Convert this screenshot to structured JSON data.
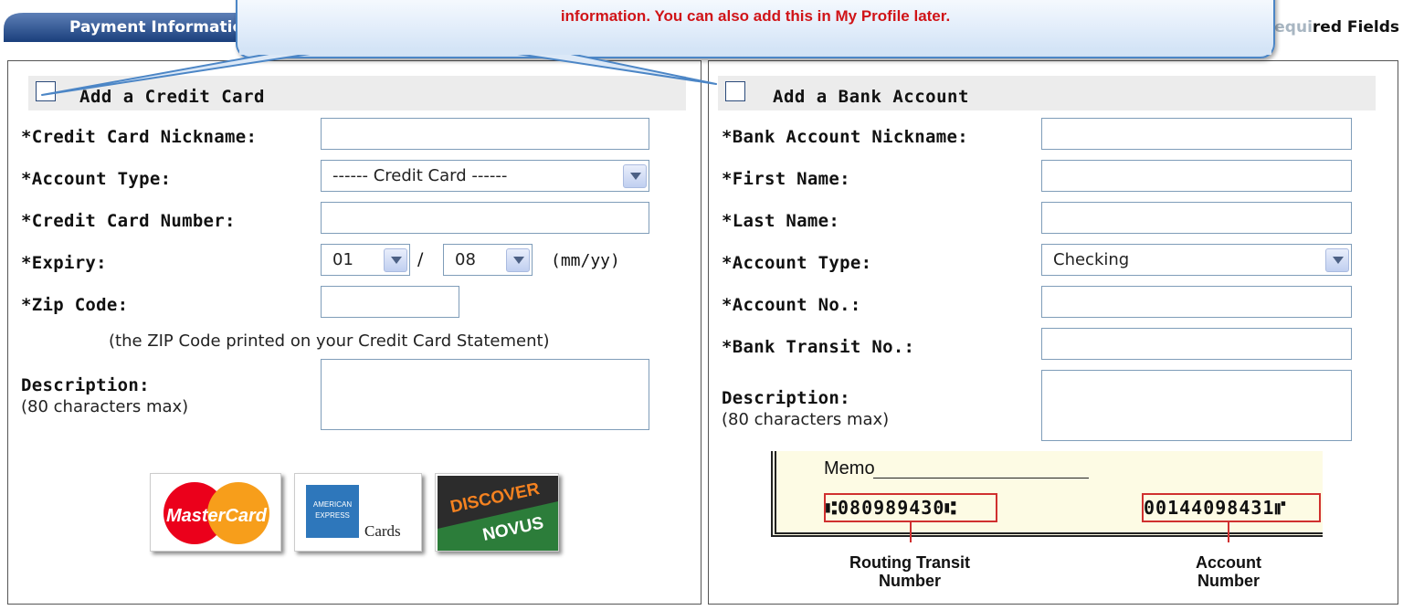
{
  "header": {
    "tab_label": "Payment Information",
    "required_star": "*",
    "required_faded": "Requi",
    "required_dark": "red Fields"
  },
  "callout": {
    "text": "information.  You can also add this in My Profile later."
  },
  "credit_card": {
    "title": "Add a Credit Card",
    "nickname_label": "*Credit Card Nickname:",
    "account_type_label": "*Account Type:",
    "account_type_value": "------ Credit Card ------",
    "number_label": "*Credit Card Number:",
    "expiry_label": "*Expiry:",
    "expiry_month": "01",
    "expiry_sep": "/",
    "expiry_year": "08",
    "expiry_format": "(mm/yy)",
    "zip_label": "*Zip Code:",
    "zip_note": "(the ZIP Code printed on your Credit Card Statement)",
    "desc_label": "Description:",
    "desc_note": "(80 characters max)",
    "logos": {
      "mastercard": "MasterCard",
      "amex_top": "AMERICAN",
      "amex_bottom": "EXPRESS",
      "amex_cards": "Cards",
      "discover": "DISCOVER",
      "novus": "NOVUS"
    }
  },
  "bank": {
    "title": "Add a Bank Account",
    "nickname_label": "*Bank Account Nickname:",
    "first_name_label": "*First Name:",
    "last_name_label": "*Last Name:",
    "account_type_label": "*Account Type:",
    "account_type_value": "Checking",
    "account_no_label": "*Account No.:",
    "transit_label": "*Bank Transit No.:",
    "desc_label": "Description:",
    "desc_note": "(80 characters max)",
    "check": {
      "memo": "Memo",
      "routing_digits": "⑆080989430⑆",
      "account_digits": "00144098431⑈",
      "routing_caption_1": "Routing Transit",
      "routing_caption_2": "Number",
      "account_caption_1": "Account",
      "account_caption_2": "Number"
    }
  },
  "colors": {
    "tab": "#1f4a8a",
    "callout_text": "#d01418",
    "callout_border": "#4c86c6",
    "field_border": "#7f9db9",
    "mastercard_red": "#eb001b",
    "mastercard_yellow": "#f79e1b",
    "amex_blue": "#2e77bb",
    "discover_orange": "#f58220",
    "novus_green": "#2c7d3a",
    "micr_box": "#d0302f"
  }
}
